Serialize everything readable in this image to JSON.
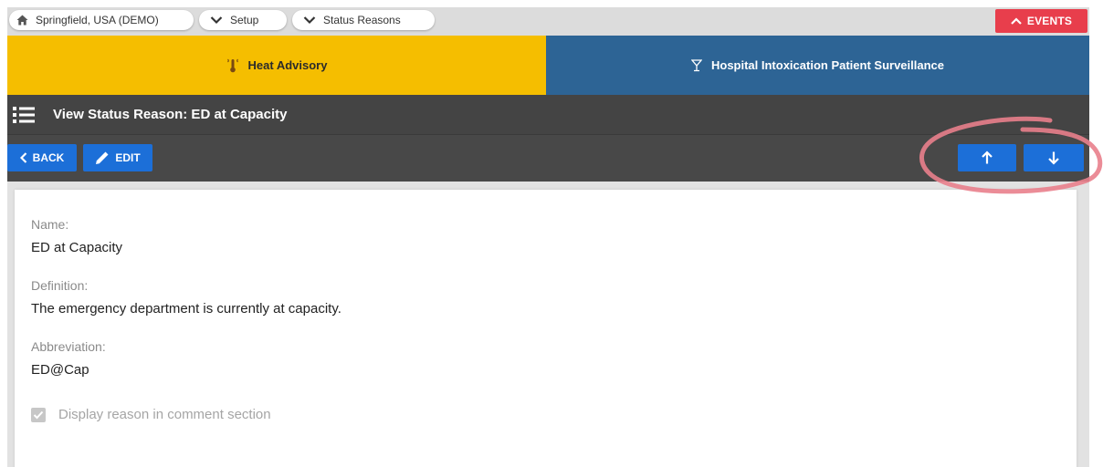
{
  "breadcrumbs": [
    {
      "label": "Springfield, USA (DEMO)",
      "icon": "home-icon"
    },
    {
      "label": "Setup",
      "icon": "chevron-down-icon"
    },
    {
      "label": "Status Reasons",
      "icon": "chevron-down-icon"
    }
  ],
  "events": {
    "label": "EVENTS",
    "icon": "chevron-up-icon",
    "color": "#e83e4c"
  },
  "alerts": [
    {
      "label": "Heat Advisory",
      "icon": "thermometer-icon",
      "color": "#f5be00"
    },
    {
      "label": "Hospital Intoxication Patient Surveillance",
      "icon": "cocktail-glass-icon",
      "color": "#2d6495"
    }
  ],
  "header": {
    "title": "View Status Reason: ED at Capacity",
    "menu_icon": "list-menu-icon"
  },
  "toolbar": {
    "back_label": "BACK",
    "edit_label": "EDIT",
    "up_icon": "arrow-up-icon",
    "down_icon": "arrow-down-icon",
    "accent": "#1c6fd8"
  },
  "details": {
    "name_label": "Name:",
    "name_value": "ED at Capacity",
    "definition_label": "Definition:",
    "definition_value": "The emergency department is currently at capacity.",
    "abbreviation_label": "Abbreviation:",
    "abbreviation_value": "ED@Cap",
    "display_checkbox_label": "Display reason in comment section",
    "display_checkbox_checked": true
  },
  "annotation": {
    "color": "#e9808c"
  }
}
